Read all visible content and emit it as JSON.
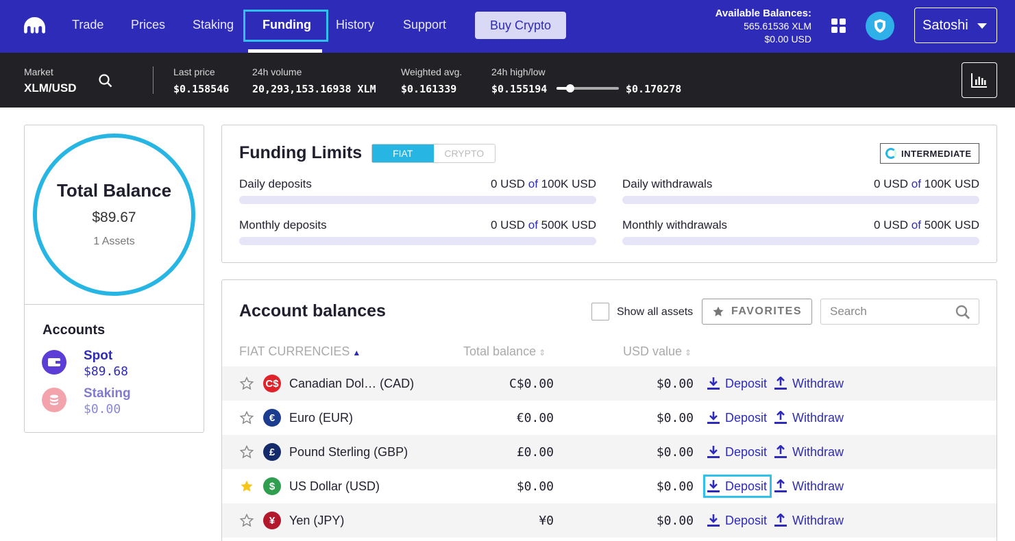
{
  "nav": {
    "items": [
      "Trade",
      "Prices",
      "Staking",
      "Funding",
      "History",
      "Support"
    ],
    "active": "Funding",
    "buy_label": "Buy Crypto",
    "balances_title": "Available Balances:",
    "balance_xlm": "565.61536 XLM",
    "balance_usd": "$0.00 USD",
    "user": "Satoshi"
  },
  "market": {
    "market_label": "Market",
    "pair": "XLM/USD",
    "last_price_label": "Last price",
    "last_price": "$0.158546",
    "volume_label": "24h volume",
    "volume": "20,293,153.16938 XLM",
    "weighted_label": "Weighted avg.",
    "weighted": "$0.161339",
    "highlow_label": "24h high/low",
    "low": "$0.155194",
    "high": "$0.170278",
    "range_position": 0.22
  },
  "summary": {
    "title": "Total Balance",
    "value": "$89.67",
    "assets": "1 Assets",
    "accounts_title": "Accounts",
    "spot_label": "Spot",
    "spot_value": "$89.68",
    "staking_label": "Staking",
    "staking_value": "$0.00"
  },
  "limits": {
    "title": "Funding Limits",
    "tab_fiat": "FIAT",
    "tab_crypto": "CRYPTO",
    "level": "INTERMEDIATE",
    "of": "of",
    "daily_deposits": {
      "label": "Daily deposits",
      "used": "0 USD",
      "max": "100K USD"
    },
    "daily_withdrawals": {
      "label": "Daily withdrawals",
      "used": "0 USD",
      "max": "100K USD"
    },
    "monthly_deposits": {
      "label": "Monthly deposits",
      "used": "0 USD",
      "max": "500K USD"
    },
    "monthly_withdrawals": {
      "label": "Monthly withdrawals",
      "used": "0 USD",
      "max": "500K USD"
    }
  },
  "balances": {
    "title": "Account balances",
    "show_all_label": "Show all assets",
    "favorites_label": "FAVORITES",
    "search_placeholder": "Search",
    "col_currency": "FIAT CURRENCIES",
    "col_total": "Total balance",
    "col_usd": "USD value",
    "deposit_label": "Deposit",
    "withdraw_label": "Withdraw",
    "rows": [
      {
        "name": "Canadian Dol…  (CAD)",
        "symbol": "C$",
        "color": "#e0232a",
        "balance": "C$0.00",
        "usd": "$0.00",
        "favorite": false
      },
      {
        "name": "Euro (EUR)",
        "symbol": "€",
        "color": "#1c3d8f",
        "balance": "€0.00",
        "usd": "$0.00",
        "favorite": false
      },
      {
        "name": "Pound Sterling (GBP)",
        "symbol": "£",
        "color": "#132a6b",
        "balance": "£0.00",
        "usd": "$0.00",
        "favorite": false
      },
      {
        "name": "US Dollar (USD)",
        "symbol": "$",
        "color": "#2f9e4f",
        "balance": "$0.00",
        "usd": "$0.00",
        "favorite": true
      },
      {
        "name": "Yen (JPY)",
        "symbol": "¥",
        "color": "#b3172b",
        "balance": "¥0",
        "usd": "$0.00",
        "favorite": false
      }
    ]
  },
  "colors": {
    "brand": "#2e2bb8",
    "accent": "#27b6e3",
    "star": "#f5c518"
  }
}
